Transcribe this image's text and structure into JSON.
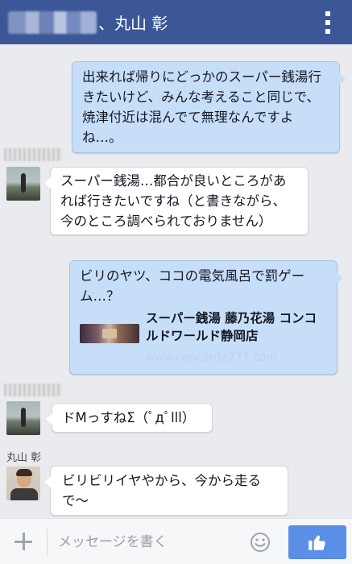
{
  "header": {
    "title": "、丸山 彰",
    "menu_icon": "overflow-menu-icon"
  },
  "messages": [
    {
      "direction": "out",
      "text": "出来れば帰りにどっかのスーパー銭湯行きたいけど、みんな考えること同じで、焼津付近は混んでて無理なんですよね…。"
    },
    {
      "direction": "in",
      "text": "スーパー銭湯…都合が良いところがあれば行きたいですね（と書きながら、今のところ調べられておりません）"
    },
    {
      "direction": "out",
      "text": "ビリのヤツ、ココの電気風呂で罰ゲーム…？",
      "link": {
        "title": "スーパー銭湯 藤乃花湯 コンコルドワールド静岡店",
        "url": "www.concorde777.com"
      }
    },
    {
      "direction": "in",
      "text": "ドMっすねΣ（ﾟдﾟlll）"
    },
    {
      "direction": "in",
      "sender": "丸山 彰",
      "text": "ビリビリイヤやから、今から走るで〜"
    }
  ],
  "composer": {
    "placeholder": "メッセージを書く",
    "value": "",
    "add_icon": "plus-icon",
    "emoji_icon": "smile-icon",
    "like_icon": "thumbs-up-icon"
  },
  "colors": {
    "header": "#3b5797",
    "outgoing_bubble": "#c7def9",
    "incoming_bubble": "#ffffff",
    "background": "#e9ebee",
    "like_button": "#5b8ee6"
  }
}
